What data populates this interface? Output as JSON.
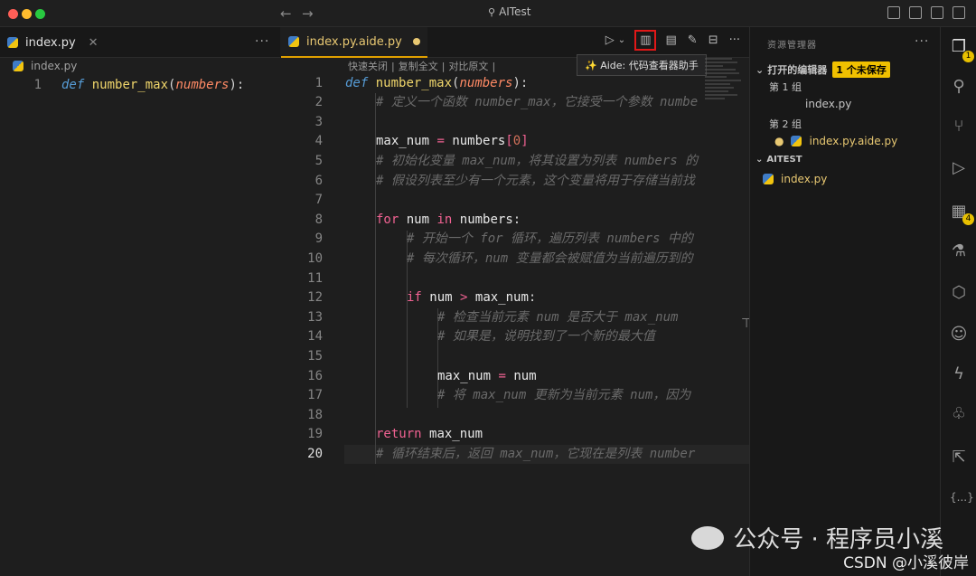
{
  "window": {
    "title": "AITest"
  },
  "left_editor": {
    "tab_label": "index.py",
    "breadcrumb": "index.py",
    "line_number": "1",
    "line": {
      "kw": "def",
      "fn": "number_max",
      "open": "(",
      "param": "numbers",
      "close": "):"
    }
  },
  "right_editor": {
    "tab_label": "index.py.aide.py",
    "actions": [
      "快速关闭",
      "复制全文",
      "对比原文"
    ],
    "tooltip": "✨ Aide: 代码查看器助手",
    "line_numbers": [
      "1",
      "2",
      "3",
      "4",
      "5",
      "6",
      "7",
      "8",
      "9",
      "10",
      "11",
      "12",
      "13",
      "14",
      "15",
      "16",
      "17",
      "18",
      "19",
      "20"
    ],
    "lines": {
      "l1": {
        "kw": "def",
        "fn": "number_max",
        "open": "(",
        "param": "numbers",
        "close": "):"
      },
      "l2": "# 定义一个函数 number_max，它接受一个参数 numbe",
      "l4": {
        "var": "max_num",
        "op": " = ",
        "obj": "numbers",
        "idx_open": "[",
        "idx": "0",
        "idx_close": "]"
      },
      "l5": "# 初始化变量 max_num，将其设置为列表 numbers 的",
      "l6": "# 假设列表至少有一个元素，这个变量将用于存储当前找",
      "l8": {
        "kw": "for",
        "a": "num",
        "in": "in",
        "b": "numbers",
        "c": ":"
      },
      "l9": "# 开始一个 for 循环，遍历列表 numbers 中的",
      "l10": "# 每次循环，num 变量都会被赋值为当前遍历到的",
      "l12": {
        "kw": "if",
        "a": "num",
        "op": " > ",
        "b": "max_num",
        "c": ":"
      },
      "l13": "# 检查当前元素 num 是否大于 max_num",
      "l14": "# 如果是，说明找到了一个新的最大值",
      "l16": {
        "a": "max_num",
        "op": " = ",
        "b": "num"
      },
      "l17": "# 将 max_num 更新为当前元素 num，因为",
      "l19": {
        "kw": "return",
        "a": "max_num"
      },
      "l20": "# 循环结束后，返回 max_num，它现在是列表 number"
    }
  },
  "explorer": {
    "title": "资源管理器",
    "open_editors": "打开的编辑器",
    "unsaved_badge": "1 个未保存",
    "group1": "第 1 组",
    "group1_file": "index.py",
    "group2": "第 2 组",
    "group2_file": "index.py.aide.py",
    "folder": "AITEST",
    "folder_file": "index.py"
  },
  "activity_badges": {
    "explorer": "1",
    "extensions": "4"
  },
  "watermark": {
    "text": "公众号 · 程序员小溪",
    "csdn": "CSDN @小溪彼岸"
  },
  "colors": {
    "keyword": "#569cd6",
    "control": "#f06292",
    "function": "#f0d66b",
    "param": "#ff8a65",
    "comment": "#6a6a6a",
    "badge": "#f0c000",
    "highlight_box": "#e01818"
  },
  "icons": [
    "python-file-icon",
    "close-icon",
    "more-icon",
    "run-icon",
    "viewer-icon",
    "edit-icon",
    "split-icon",
    "files-icon",
    "search-icon",
    "source-control-icon",
    "debug-icon",
    "extensions-icon",
    "flask-icon",
    "robot-icon",
    "bolt-icon",
    "tree-icon",
    "braces-icon"
  ]
}
